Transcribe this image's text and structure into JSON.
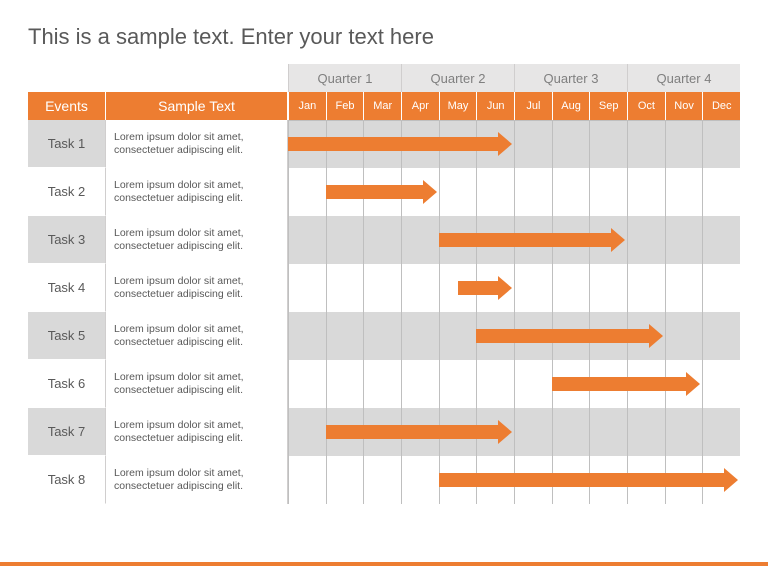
{
  "title": "This is a sample text. Enter your text here",
  "headers": {
    "events": "Events",
    "sample": "Sample Text",
    "quarters": [
      "Quarter 1",
      "Quarter 2",
      "Quarter 3",
      "Quarter 4"
    ],
    "months": [
      "Jan",
      "Feb",
      "Mar",
      "Apr",
      "May",
      "Jun",
      "Jul",
      "Aug",
      "Sep",
      "Oct",
      "Nov",
      "Dec"
    ]
  },
  "desc": "Lorem ipsum dolor sit amet, consectetuer adipiscing elit.",
  "tasks": [
    {
      "name": "Task 1",
      "start": 0,
      "end": 6
    },
    {
      "name": "Task 2",
      "start": 1,
      "end": 4
    },
    {
      "name": "Task 3",
      "start": 4,
      "end": 9
    },
    {
      "name": "Task 4",
      "start": 4.5,
      "end": 6
    },
    {
      "name": "Task 5",
      "start": 5,
      "end": 10
    },
    {
      "name": "Task 6",
      "start": 7,
      "end": 11
    },
    {
      "name": "Task 7",
      "start": 1,
      "end": 6
    },
    {
      "name": "Task 8",
      "start": 4,
      "end": 12
    }
  ],
  "colors": {
    "accent": "#ED7D31",
    "grey": "#D9D9D9",
    "lightgrey": "#E7E6E6"
  },
  "chart_data": {
    "type": "bar",
    "title": "This is a sample text. Enter your text here",
    "xlabel": "",
    "ylabel": "",
    "x_categories": [
      "Jan",
      "Feb",
      "Mar",
      "Apr",
      "May",
      "Jun",
      "Jul",
      "Aug",
      "Sep",
      "Oct",
      "Nov",
      "Dec"
    ],
    "x_groups": [
      "Quarter 1",
      "Quarter 2",
      "Quarter 3",
      "Quarter 4"
    ],
    "series": [
      {
        "name": "Task 1",
        "start_month": "Jan",
        "end_month": "Jul",
        "start": 1,
        "end": 7
      },
      {
        "name": "Task 2",
        "start_month": "Feb",
        "end_month": "May",
        "start": 2,
        "end": 5
      },
      {
        "name": "Task 3",
        "start_month": "May",
        "end_month": "Oct",
        "start": 5,
        "end": 10
      },
      {
        "name": "Task 4",
        "start_month": "May",
        "end_month": "Jul",
        "start": 5.5,
        "end": 7
      },
      {
        "name": "Task 5",
        "start_month": "Jun",
        "end_month": "Nov",
        "start": 6,
        "end": 11
      },
      {
        "name": "Task 6",
        "start_month": "Aug",
        "end_month": "Dec",
        "start": 8,
        "end": 12
      },
      {
        "name": "Task 7",
        "start_month": "Feb",
        "end_month": "Jul",
        "start": 2,
        "end": 7
      },
      {
        "name": "Task 8",
        "start_month": "May",
        "end_month": "Dec",
        "start": 5,
        "end": 13
      }
    ],
    "xlim": [
      1,
      12
    ]
  }
}
